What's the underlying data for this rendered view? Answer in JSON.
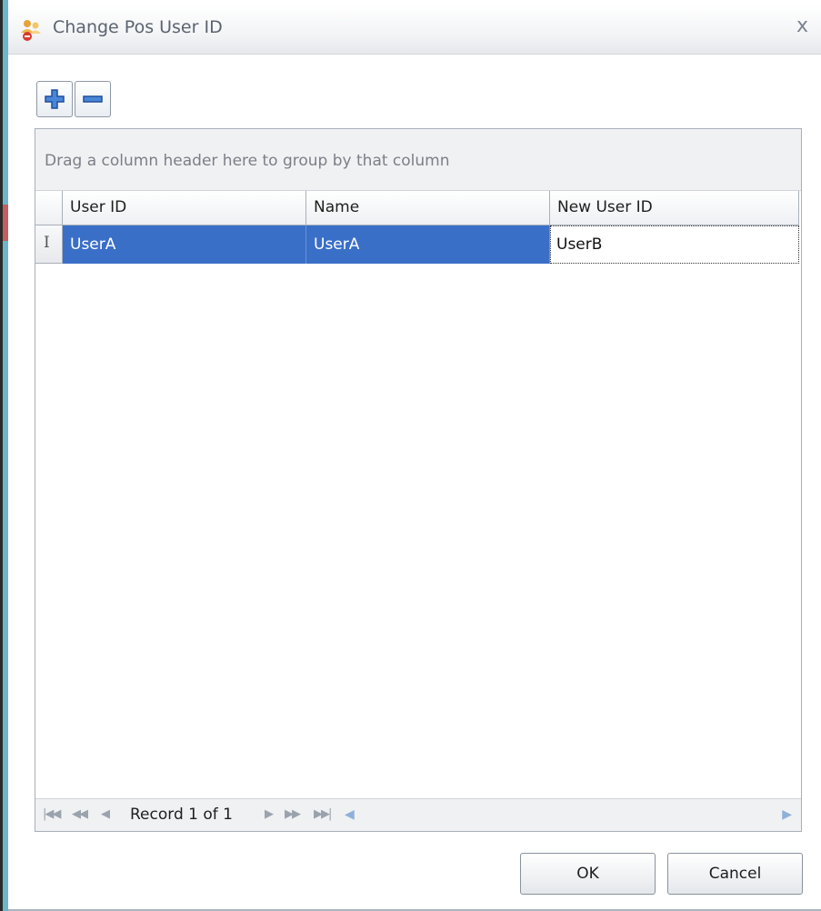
{
  "window": {
    "title": "Change Pos User ID",
    "close_label": "x"
  },
  "toolbar": {
    "add_icon": "plus-icon",
    "remove_icon": "minus-icon"
  },
  "grid": {
    "group_panel_text": "Drag a column header here to group by that column",
    "columns": [
      "User ID",
      "Name",
      "New User ID"
    ],
    "rows": [
      {
        "user_id": "UserA",
        "name": "UserA",
        "new_user_id": "UserB"
      }
    ],
    "row_indicator": "I",
    "selection_color": "#3a6fc8"
  },
  "navigator": {
    "record_text": "Record 1 of 1",
    "first_icon": "first-record-icon",
    "prev_page_icon": "previous-page-icon",
    "prev_icon": "previous-record-icon",
    "next_icon": "next-record-icon",
    "next_page_icon": "next-page-icon",
    "last_icon": "last-record-icon"
  },
  "buttons": {
    "ok": "OK",
    "cancel": "Cancel"
  }
}
